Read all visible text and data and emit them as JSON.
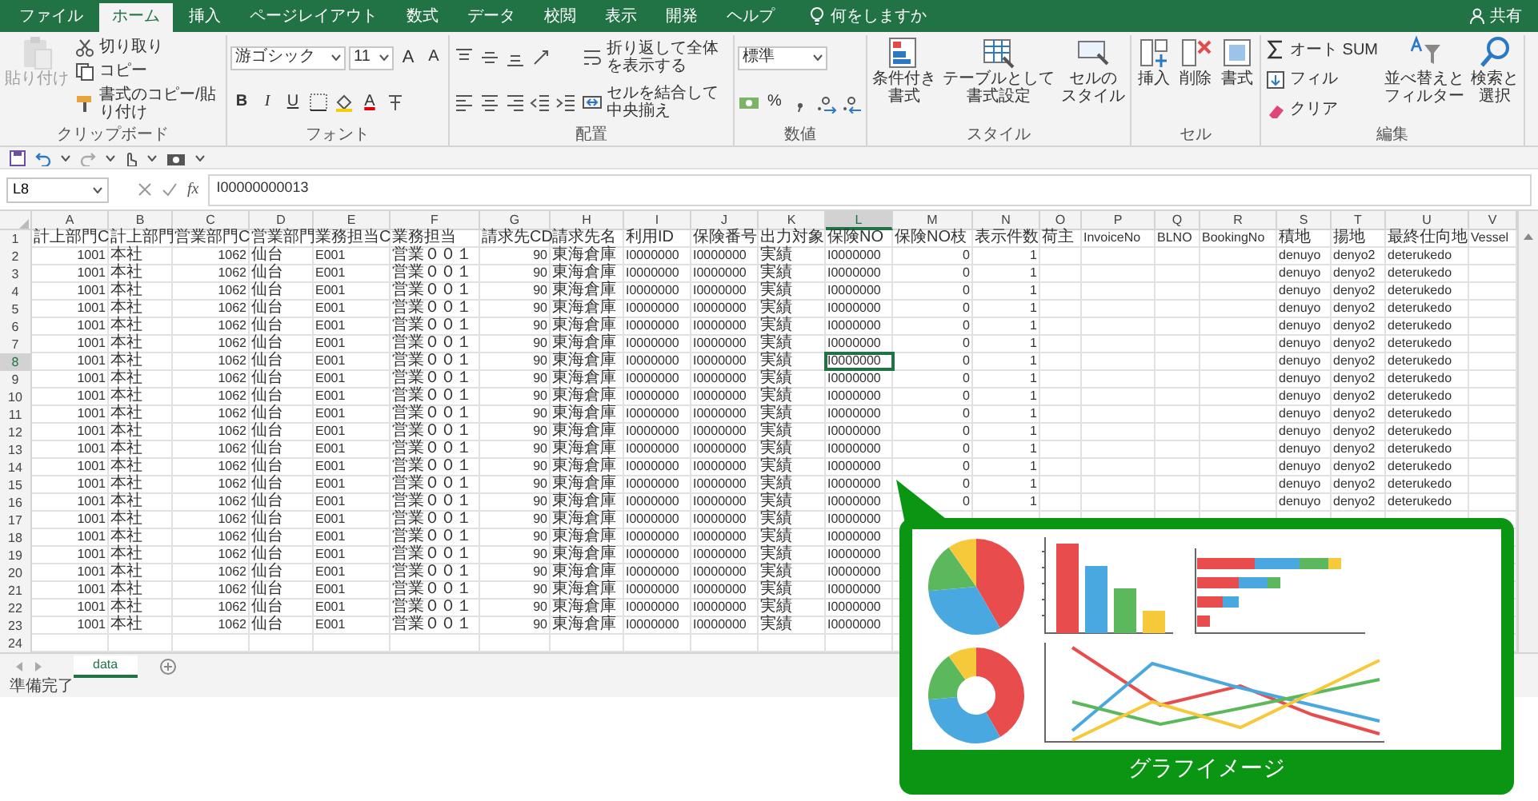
{
  "ribbon_tabs": [
    {
      "label": "ファイル",
      "selected": false
    },
    {
      "label": "ホーム",
      "selected": true
    },
    {
      "label": "挿入",
      "selected": false
    },
    {
      "label": "ページレイアウト",
      "selected": false
    },
    {
      "label": "数式",
      "selected": false
    },
    {
      "label": "データ",
      "selected": false
    },
    {
      "label": "校閲",
      "selected": false
    },
    {
      "label": "表示",
      "selected": false
    },
    {
      "label": "開発",
      "selected": false
    },
    {
      "label": "ヘルプ",
      "selected": false
    }
  ],
  "tell_me": "何をしますか",
  "share": "共有",
  "ribbon_groups": [
    {
      "label": "クリップボード",
      "items": [
        {
          "kind": "large",
          "label_lines": [
            "貼り付け"
          ],
          "disabled": true
        },
        {
          "kind": "stack",
          "items": [
            {
              "kind": "small",
              "label": "切り取り"
            },
            {
              "kind": "small",
              "label": "コピー"
            },
            {
              "kind": "small",
              "label": "書式のコピー/貼り付け"
            }
          ]
        }
      ]
    },
    {
      "label": "フォント",
      "items": [
        {
          "kind": "stack",
          "items": [
            {
              "kind": "row",
              "items": [
                {
                  "kind": "select",
                  "value": "游ゴシック"
                },
                {
                  "kind": "select",
                  "value": "11"
                },
                {
                  "kind": "grow",
                  "label": "A"
                },
                {
                  "kind": "shrink",
                  "label": "A"
                }
              ]
            },
            {
              "kind": "row",
              "items": [
                {
                  "kind": "bold",
                  "label": "B"
                },
                {
                  "kind": "italic",
                  "label": "I"
                },
                {
                  "kind": "underline",
                  "label": "U"
                },
                {
                  "kind": "icon"
                },
                {
                  "kind": "icon"
                },
                {
                  "kind": "fontcolor",
                  "label": "A"
                },
                {
                  "kind": "icon"
                }
              ]
            }
          ]
        }
      ]
    },
    {
      "label": "配置",
      "items": [
        {
          "kind": "stack",
          "items": [
            {
              "kind": "row",
              "items": [
                {
                  "kind": "icon"
                },
                {
                  "kind": "icon"
                },
                {
                  "kind": "icon"
                },
                {
                  "kind": "icon"
                }
              ]
            },
            {
              "kind": "row",
              "items": [
                {
                  "kind": "icon"
                },
                {
                  "kind": "icon"
                },
                {
                  "kind": "icon"
                },
                {
                  "kind": "icon"
                },
                {
                  "kind": "icon"
                }
              ]
            }
          ]
        },
        {
          "kind": "stack",
          "items": [
            {
              "kind": "small",
              "label": "折り返して全体を表示する"
            },
            {
              "kind": "small",
              "label": "セルを結合して中央揃え"
            }
          ]
        }
      ]
    },
    {
      "label": "数値",
      "items": [
        {
          "kind": "stack",
          "items": [
            {
              "kind": "row",
              "items": [
                {
                  "kind": "select",
                  "value": "標準"
                }
              ]
            },
            {
              "kind": "row",
              "items": [
                {
                  "kind": "icon"
                },
                {
                  "kind": "plain",
                  "label": "%"
                },
                {
                  "kind": "icon"
                },
                {
                  "kind": "icon"
                },
                {
                  "kind": "icon"
                }
              ]
            }
          ]
        }
      ]
    },
    {
      "label": "スタイル",
      "items": [
        {
          "kind": "large",
          "label_lines": [
            "条件付き",
            "書式"
          ],
          "disabled": false
        },
        {
          "kind": "large",
          "label_lines": [
            "テーブルとして",
            "書式設定"
          ],
          "disabled": false
        },
        {
          "kind": "large",
          "label_lines": [
            "セルの",
            "スタイル"
          ],
          "disabled": false
        }
      ]
    },
    {
      "label": "セル",
      "items": [
        {
          "kind": "large",
          "label_lines": [
            "挿入"
          ],
          "disabled": false
        },
        {
          "kind": "large",
          "label_lines": [
            "削除"
          ],
          "disabled": false
        },
        {
          "kind": "large",
          "label_lines": [
            "書式"
          ],
          "disabled": false
        }
      ]
    },
    {
      "label": "編集",
      "items": [
        {
          "kind": "stack",
          "items": [
            {
              "kind": "small",
              "label": "オート SUM"
            },
            {
              "kind": "small",
              "label": "フィル"
            },
            {
              "kind": "small",
              "label": "クリア"
            }
          ]
        },
        {
          "kind": "large",
          "label_lines": [
            "並べ替えと",
            "フィルター"
          ],
          "disabled": false
        },
        {
          "kind": "large",
          "label_lines": [
            "検索と",
            "選択"
          ],
          "disabled": false
        }
      ]
    }
  ],
  "formula_bar": {
    "name_box": "L8",
    "function_label": "fx",
    "value": "I00000000013"
  },
  "columns": [
    {
      "letter": "A",
      "selected": false
    },
    {
      "letter": "B",
      "selected": false
    },
    {
      "letter": "C",
      "selected": false
    },
    {
      "letter": "D",
      "selected": false
    },
    {
      "letter": "E",
      "selected": false
    },
    {
      "letter": "F",
      "selected": false
    },
    {
      "letter": "G",
      "selected": false
    },
    {
      "letter": "H",
      "selected": false
    },
    {
      "letter": "I",
      "selected": false
    },
    {
      "letter": "J",
      "selected": false
    },
    {
      "letter": "K",
      "selected": false
    },
    {
      "letter": "L",
      "selected": true
    },
    {
      "letter": "M",
      "selected": false
    },
    {
      "letter": "N",
      "selected": false
    },
    {
      "letter": "O",
      "selected": false
    },
    {
      "letter": "P",
      "selected": false
    },
    {
      "letter": "Q",
      "selected": false
    },
    {
      "letter": "R",
      "selected": false
    },
    {
      "letter": "S",
      "selected": false
    },
    {
      "letter": "T",
      "selected": false
    },
    {
      "letter": "U",
      "selected": false
    },
    {
      "letter": "V",
      "selected": false
    }
  ],
  "rows": [
    {
      "number": "1",
      "selected": false,
      "cells": {
        "A": "計上部門C",
        "B": "計上部門",
        "C": "営業部門C",
        "D": "営業部門",
        "E": "業務担当C",
        "F": "業務担当",
        "G": "請求先CD",
        "H": "請求先名",
        "I": "利用ID",
        "J": "保険番号",
        "K": "出力対象",
        "L": "保険NO",
        "M": "保険NO枝",
        "N": "表示件数",
        "O": "荷主",
        "P": "InvoiceNo",
        "Q": "BLNO",
        "R": "BookingNo",
        "S": "積地",
        "T": "揚地",
        "U": "最終仕向地",
        "V": "Vessel"
      }
    },
    {
      "number": "2",
      "selected": false,
      "cells": {
        "A": "1001",
        "B": "本社",
        "C": "1062",
        "D": "仙台",
        "E": "E001",
        "F": "営業００１",
        "G": "90",
        "H": "東海倉庫",
        "I": "I0000000",
        "J": "I0000000",
        "K": "実績",
        "L": "I0000000",
        "M": "0",
        "N": "1",
        "S": "denuyo",
        "T": "denyo2",
        "U": "deterukedo"
      }
    },
    {
      "number": "3",
      "selected": false,
      "cells": {
        "A": "1001",
        "B": "本社",
        "C": "1062",
        "D": "仙台",
        "E": "E001",
        "F": "営業００１",
        "G": "90",
        "H": "東海倉庫",
        "I": "I0000000",
        "J": "I0000000",
        "K": "実績",
        "L": "I0000000",
        "M": "0",
        "N": "1",
        "S": "denuyo",
        "T": "denyo2",
        "U": "deterukedo"
      }
    },
    {
      "number": "4",
      "selected": false,
      "cells": {
        "A": "1001",
        "B": "本社",
        "C": "1062",
        "D": "仙台",
        "E": "E001",
        "F": "営業００１",
        "G": "90",
        "H": "東海倉庫",
        "I": "I0000000",
        "J": "I0000000",
        "K": "実績",
        "L": "I0000000",
        "M": "0",
        "N": "1",
        "S": "denuyo",
        "T": "denyo2",
        "U": "deterukedo"
      }
    },
    {
      "number": "5",
      "selected": false,
      "cells": {
        "A": "1001",
        "B": "本社",
        "C": "1062",
        "D": "仙台",
        "E": "E001",
        "F": "営業００１",
        "G": "90",
        "H": "東海倉庫",
        "I": "I0000000",
        "J": "I0000000",
        "K": "実績",
        "L": "I0000000",
        "M": "0",
        "N": "1",
        "S": "denuyo",
        "T": "denyo2",
        "U": "deterukedo"
      }
    },
    {
      "number": "6",
      "selected": false,
      "cells": {
        "A": "1001",
        "B": "本社",
        "C": "1062",
        "D": "仙台",
        "E": "E001",
        "F": "営業００１",
        "G": "90",
        "H": "東海倉庫",
        "I": "I0000000",
        "J": "I0000000",
        "K": "実績",
        "L": "I0000000",
        "M": "0",
        "N": "1",
        "S": "denuyo",
        "T": "denyo2",
        "U": "deterukedo"
      }
    },
    {
      "number": "7",
      "selected": false,
      "cells": {
        "A": "1001",
        "B": "本社",
        "C": "1062",
        "D": "仙台",
        "E": "E001",
        "F": "営業００１",
        "G": "90",
        "H": "東海倉庫",
        "I": "I0000000",
        "J": "I0000000",
        "K": "実績",
        "L": "I0000000",
        "M": "0",
        "N": "1",
        "S": "denuyo",
        "T": "denyo2",
        "U": "deterukedo"
      }
    },
    {
      "number": "8",
      "selected": true,
      "cells": {
        "A": "1001",
        "B": "本社",
        "C": "1062",
        "D": "仙台",
        "E": "E001",
        "F": "営業００１",
        "G": "90",
        "H": "東海倉庫",
        "I": "I0000000",
        "J": "I0000000",
        "K": "実績",
        "L": "I0000000",
        "M": "0",
        "N": "1",
        "S": "denuyo",
        "T": "denyo2",
        "U": "deterukedo"
      }
    },
    {
      "number": "9",
      "selected": false,
      "cells": {
        "A": "1001",
        "B": "本社",
        "C": "1062",
        "D": "仙台",
        "E": "E001",
        "F": "営業００１",
        "G": "90",
        "H": "東海倉庫",
        "I": "I0000000",
        "J": "I0000000",
        "K": "実績",
        "L": "I0000000",
        "M": "0",
        "N": "1",
        "S": "denuyo",
        "T": "denyo2",
        "U": "deterukedo"
      }
    },
    {
      "number": "10",
      "selected": false,
      "cells": {
        "A": "1001",
        "B": "本社",
        "C": "1062",
        "D": "仙台",
        "E": "E001",
        "F": "営業００１",
        "G": "90",
        "H": "東海倉庫",
        "I": "I0000000",
        "J": "I0000000",
        "K": "実績",
        "L": "I0000000",
        "M": "0",
        "N": "1",
        "S": "denuyo",
        "T": "denyo2",
        "U": "deterukedo"
      }
    },
    {
      "number": "11",
      "selected": false,
      "cells": {
        "A": "1001",
        "B": "本社",
        "C": "1062",
        "D": "仙台",
        "E": "E001",
        "F": "営業００１",
        "G": "90",
        "H": "東海倉庫",
        "I": "I0000000",
        "J": "I0000000",
        "K": "実績",
        "L": "I0000000",
        "M": "0",
        "N": "1",
        "S": "denuyo",
        "T": "denyo2",
        "U": "deterukedo"
      }
    },
    {
      "number": "12",
      "selected": false,
      "cells": {
        "A": "1001",
        "B": "本社",
        "C": "1062",
        "D": "仙台",
        "E": "E001",
        "F": "営業００１",
        "G": "90",
        "H": "東海倉庫",
        "I": "I0000000",
        "J": "I0000000",
        "K": "実績",
        "L": "I0000000",
        "M": "0",
        "N": "1",
        "S": "denuyo",
        "T": "denyo2",
        "U": "deterukedo"
      }
    },
    {
      "number": "13",
      "selected": false,
      "cells": {
        "A": "1001",
        "B": "本社",
        "C": "1062",
        "D": "仙台",
        "E": "E001",
        "F": "営業００１",
        "G": "90",
        "H": "東海倉庫",
        "I": "I0000000",
        "J": "I0000000",
        "K": "実績",
        "L": "I0000000",
        "M": "0",
        "N": "1",
        "S": "denuyo",
        "T": "denyo2",
        "U": "deterukedo"
      }
    },
    {
      "number": "14",
      "selected": false,
      "cells": {
        "A": "1001",
        "B": "本社",
        "C": "1062",
        "D": "仙台",
        "E": "E001",
        "F": "営業００１",
        "G": "90",
        "H": "東海倉庫",
        "I": "I0000000",
        "J": "I0000000",
        "K": "実績",
        "L": "I0000000",
        "M": "0",
        "N": "1",
        "S": "denuyo",
        "T": "denyo2",
        "U": "deterukedo"
      }
    },
    {
      "number": "15",
      "selected": false,
      "cells": {
        "A": "1001",
        "B": "本社",
        "C": "1062",
        "D": "仙台",
        "E": "E001",
        "F": "営業００１",
        "G": "90",
        "H": "東海倉庫",
        "I": "I0000000",
        "J": "I0000000",
        "K": "実績",
        "L": "I0000000",
        "M": "0",
        "N": "1",
        "S": "denuyo",
        "T": "denyo2",
        "U": "deterukedo"
      }
    },
    {
      "number": "16",
      "selected": false,
      "cells": {
        "A": "1001",
        "B": "本社",
        "C": "1062",
        "D": "仙台",
        "E": "E001",
        "F": "営業００１",
        "G": "90",
        "H": "東海倉庫",
        "I": "I0000000",
        "J": "I0000000",
        "K": "実績",
        "L": "I0000000",
        "M": "0",
        "N": "1",
        "S": "denuyo",
        "T": "denyo2",
        "U": "deterukedo"
      }
    },
    {
      "number": "17",
      "selected": false,
      "cells": {
        "A": "1001",
        "B": "本社",
        "C": "1062",
        "D": "仙台",
        "E": "E001",
        "F": "営業００１",
        "G": "90",
        "H": "東海倉庫",
        "I": "I0000000",
        "J": "I0000000",
        "K": "実績",
        "L": "I0000000"
      }
    },
    {
      "number": "18",
      "selected": false,
      "cells": {
        "A": "1001",
        "B": "本社",
        "C": "1062",
        "D": "仙台",
        "E": "E001",
        "F": "営業００１",
        "G": "90",
        "H": "東海倉庫",
        "I": "I0000000",
        "J": "I0000000",
        "K": "実績",
        "L": "I0000000"
      }
    },
    {
      "number": "19",
      "selected": false,
      "cells": {
        "A": "1001",
        "B": "本社",
        "C": "1062",
        "D": "仙台",
        "E": "E001",
        "F": "営業００１",
        "G": "90",
        "H": "東海倉庫",
        "I": "I0000000",
        "J": "I0000000",
        "K": "実績",
        "L": "I0000000"
      }
    },
    {
      "number": "20",
      "selected": false,
      "cells": {
        "A": "1001",
        "B": "本社",
        "C": "1062",
        "D": "仙台",
        "E": "E001",
        "F": "営業００１",
        "G": "90",
        "H": "東海倉庫",
        "I": "I0000000",
        "J": "I0000000",
        "K": "実績",
        "L": "I0000000"
      }
    },
    {
      "number": "21",
      "selected": false,
      "cells": {
        "A": "1001",
        "B": "本社",
        "C": "1062",
        "D": "仙台",
        "E": "E001",
        "F": "営業００１",
        "G": "90",
        "H": "東海倉庫",
        "I": "I0000000",
        "J": "I0000000",
        "K": "実績",
        "L": "I0000000"
      }
    },
    {
      "number": "22",
      "selected": false,
      "cells": {
        "A": "1001",
        "B": "本社",
        "C": "1062",
        "D": "仙台",
        "E": "E001",
        "F": "営業００１",
        "G": "90",
        "H": "東海倉庫",
        "I": "I0000000",
        "J": "I0000000",
        "K": "実績",
        "L": "I0000000"
      }
    },
    {
      "number": "23",
      "selected": false,
      "cells": {
        "A": "1001",
        "B": "本社",
        "C": "1062",
        "D": "仙台",
        "E": "E001",
        "F": "営業００１",
        "G": "90",
        "H": "東海倉庫",
        "I": "I0000000",
        "J": "I0000000",
        "K": "実績",
        "L": "I0000000"
      }
    },
    {
      "number": "24",
      "selected": false
    }
  ],
  "sheet_tabs": [
    {
      "label": "data",
      "selected": true
    }
  ],
  "status_bar": "準備完了",
  "callout": {
    "label": "グラフイメージ"
  }
}
